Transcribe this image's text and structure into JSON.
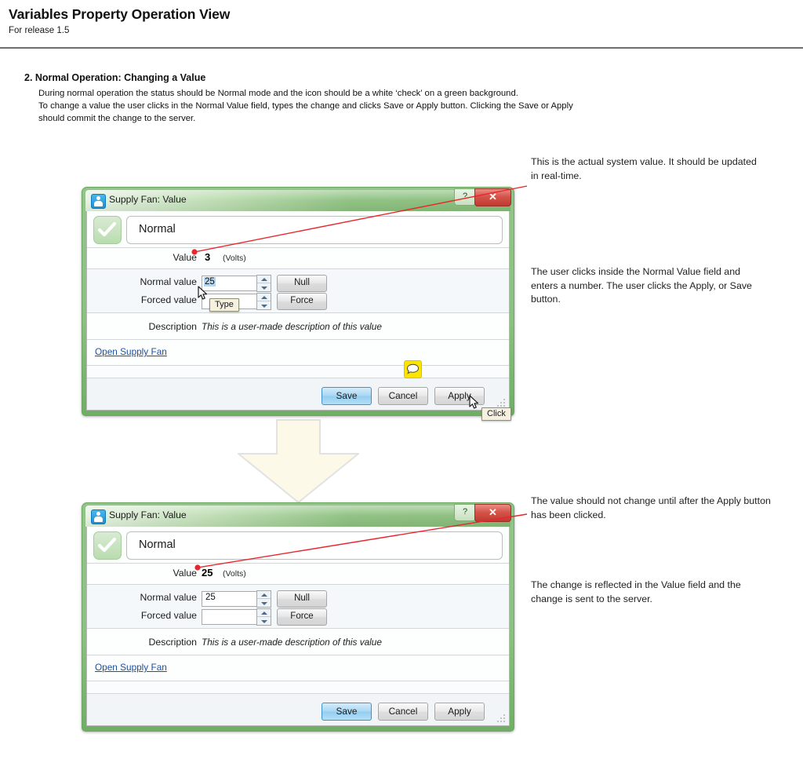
{
  "header": {
    "title": "Variables Property Operation View",
    "subtitle": "For release 1.5"
  },
  "section": {
    "heading": "2. Normal Operation: Changing a Value",
    "lines": [
      "During normal operation the status should be Normal mode and the icon should be a white ‘check’ on a green background.",
      "To change a value the user clicks in the Normal Value field, types the change and clicks Save or Apply button. Clicking the Save or Apply",
      "should commit the change to the server."
    ]
  },
  "annotations": {
    "a1": "This is the actual system value. It should be updated in real-time.",
    "a2": "The user clicks inside the Normal Value field and enters a number. The user clicks the Apply, or Save button.",
    "a3": "The value should not change until after the Apply button has been clicked.",
    "a4": "The change is reflected in the Value field and the change is sent to the server."
  },
  "dialog_before": {
    "title": "Supply Fan: Value",
    "app_icon": "user-icon",
    "help_label": "?",
    "close_label": "✕",
    "status_label": "Normal",
    "status_icon": "check-icon",
    "value_label": "Value",
    "value_number": "3",
    "value_unit": "(Volts)",
    "normal_label": "Normal value",
    "normal_value": "25",
    "forced_label": "Forced value",
    "forced_value": "",
    "null_button": "Null",
    "force_button": "Force",
    "description_label": "Description",
    "description_text": "This is a user-made description of this value",
    "link": "Open Supply Fan",
    "save_button": "Save",
    "cancel_button": "Cancel",
    "apply_button": "Apply",
    "tooltip_type": "Type",
    "tooltip_click": "Click",
    "note_icon": "comment-icon"
  },
  "dialog_after": {
    "title": "Supply Fan: Value",
    "app_icon": "user-icon",
    "help_label": "?",
    "close_label": "✕",
    "status_label": "Normal",
    "status_icon": "check-icon",
    "value_label": "Value",
    "value_number": "25",
    "value_unit": "(Volts)",
    "normal_label": "Normal value",
    "normal_value": "25",
    "forced_label": "Forced value",
    "forced_value": "",
    "null_button": "Null",
    "force_button": "Force",
    "description_label": "Description",
    "description_text": "This is a user-made description of this value",
    "link": "Open Supply Fan",
    "save_button": "Save",
    "cancel_button": "Cancel",
    "apply_button": "Apply"
  },
  "colors": {
    "window_frame_green": "#8dc183",
    "titlebar_green": "#8cc07f",
    "close_red": "#bf3a30",
    "status_green": "#b9dcaf",
    "primary_button_blue": "#93cdf1",
    "link_blue": "#1d4f9c",
    "leader_red": "#e8262d",
    "note_yellow": "#ffe400",
    "arrow_cream": "#fcf9e8"
  }
}
